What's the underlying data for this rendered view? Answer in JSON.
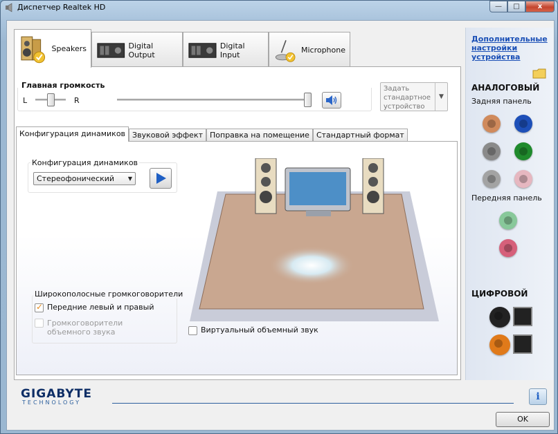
{
  "window": {
    "title": "Диспетчер Realtek HD",
    "minimize": "—",
    "maximize": "□",
    "close": "x"
  },
  "top_tabs": [
    {
      "label": "Speakers",
      "icon": "speakers-icon",
      "active": true
    },
    {
      "label": "Digital Output",
      "icon": "digital-output-icon",
      "active": false
    },
    {
      "label": "Digital Input",
      "icon": "digital-input-icon",
      "active": false
    },
    {
      "label": "Microphone",
      "icon": "microphone-icon",
      "active": false
    }
  ],
  "volume": {
    "title": "Главная громкость",
    "left": "L",
    "right": "R",
    "balance": 0.5,
    "level": 1.0
  },
  "default_device": {
    "label": "Задать стандартное устройство",
    "arrow": "▼"
  },
  "sub_tabs": [
    {
      "label": "Конфигурация динамиков",
      "active": true
    },
    {
      "label": "Звуковой эффект",
      "active": false
    },
    {
      "label": "Поправка на помещение",
      "active": false
    },
    {
      "label": "Стандартный формат",
      "active": false
    }
  ],
  "speaker_config": {
    "group_label": "Конфигурация динамиков",
    "selected": "Стереофонический",
    "dd_arrow": "▼"
  },
  "wideband": {
    "group_label": "Широкополосные громкоговорители",
    "front": {
      "label": "Передние левый и правый",
      "checked": true
    },
    "surround": {
      "label": "Громкоговорители объемного звука",
      "checked": false,
      "disabled": true
    }
  },
  "virtual_surround": {
    "label": "Виртуальный объемный звук",
    "checked": false
  },
  "right_panel": {
    "advanced_link": "Дополнительные настройки устройства",
    "analog": "АНАЛОГОВЫЙ",
    "rear_panel": "Задняя панель",
    "front_panel": "Передняя панель",
    "digital": "ЦИФРОВОЙ",
    "rear_jacks": [
      "#d08a5c",
      "#1d4fb8",
      "#8a8a8a",
      "#1f8a2c",
      "#a3a3a3",
      "#e6b7c0"
    ],
    "front_jacks": [
      "#88c89a",
      "#d6607a"
    ],
    "digital_jacks": [
      "#222222",
      "#e07a1a"
    ]
  },
  "footer": {
    "brand": "GIGABYTE",
    "brand_sub": "TECHNOLOGY",
    "info": "i",
    "ok": "OK"
  }
}
